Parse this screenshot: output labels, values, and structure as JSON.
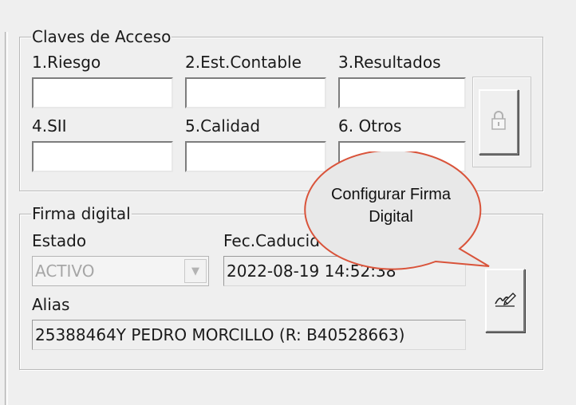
{
  "access_keys": {
    "title": "Claves de Acceso",
    "fields": [
      {
        "label": "1.Riesgo",
        "value": ""
      },
      {
        "label": "2.Est.Contable",
        "value": ""
      },
      {
        "label": "3.Resultados",
        "value": ""
      },
      {
        "label": "4.SII",
        "value": ""
      },
      {
        "label": "5.Calidad",
        "value": ""
      },
      {
        "label": "6. Otros",
        "value": ""
      }
    ],
    "lock_button_icon": "lock-icon"
  },
  "digital_signature": {
    "title": "Firma digital",
    "status_label": "Estado",
    "status_value": "ACTIVO",
    "expiry_label": "Fec.Caducid",
    "expiry_value": "2022-08-19 14:52:38",
    "alias_label": "Alias",
    "alias_value": "25388464Y PEDRO MORCILLO (R: B40528663)",
    "configure_button_icon": "signature-pen-icon"
  },
  "tooltip": {
    "text_line1": "Configurar Firma",
    "text_line2": "Digital",
    "fill_color": "#e8e8e8",
    "border_color": "#d9533a"
  }
}
